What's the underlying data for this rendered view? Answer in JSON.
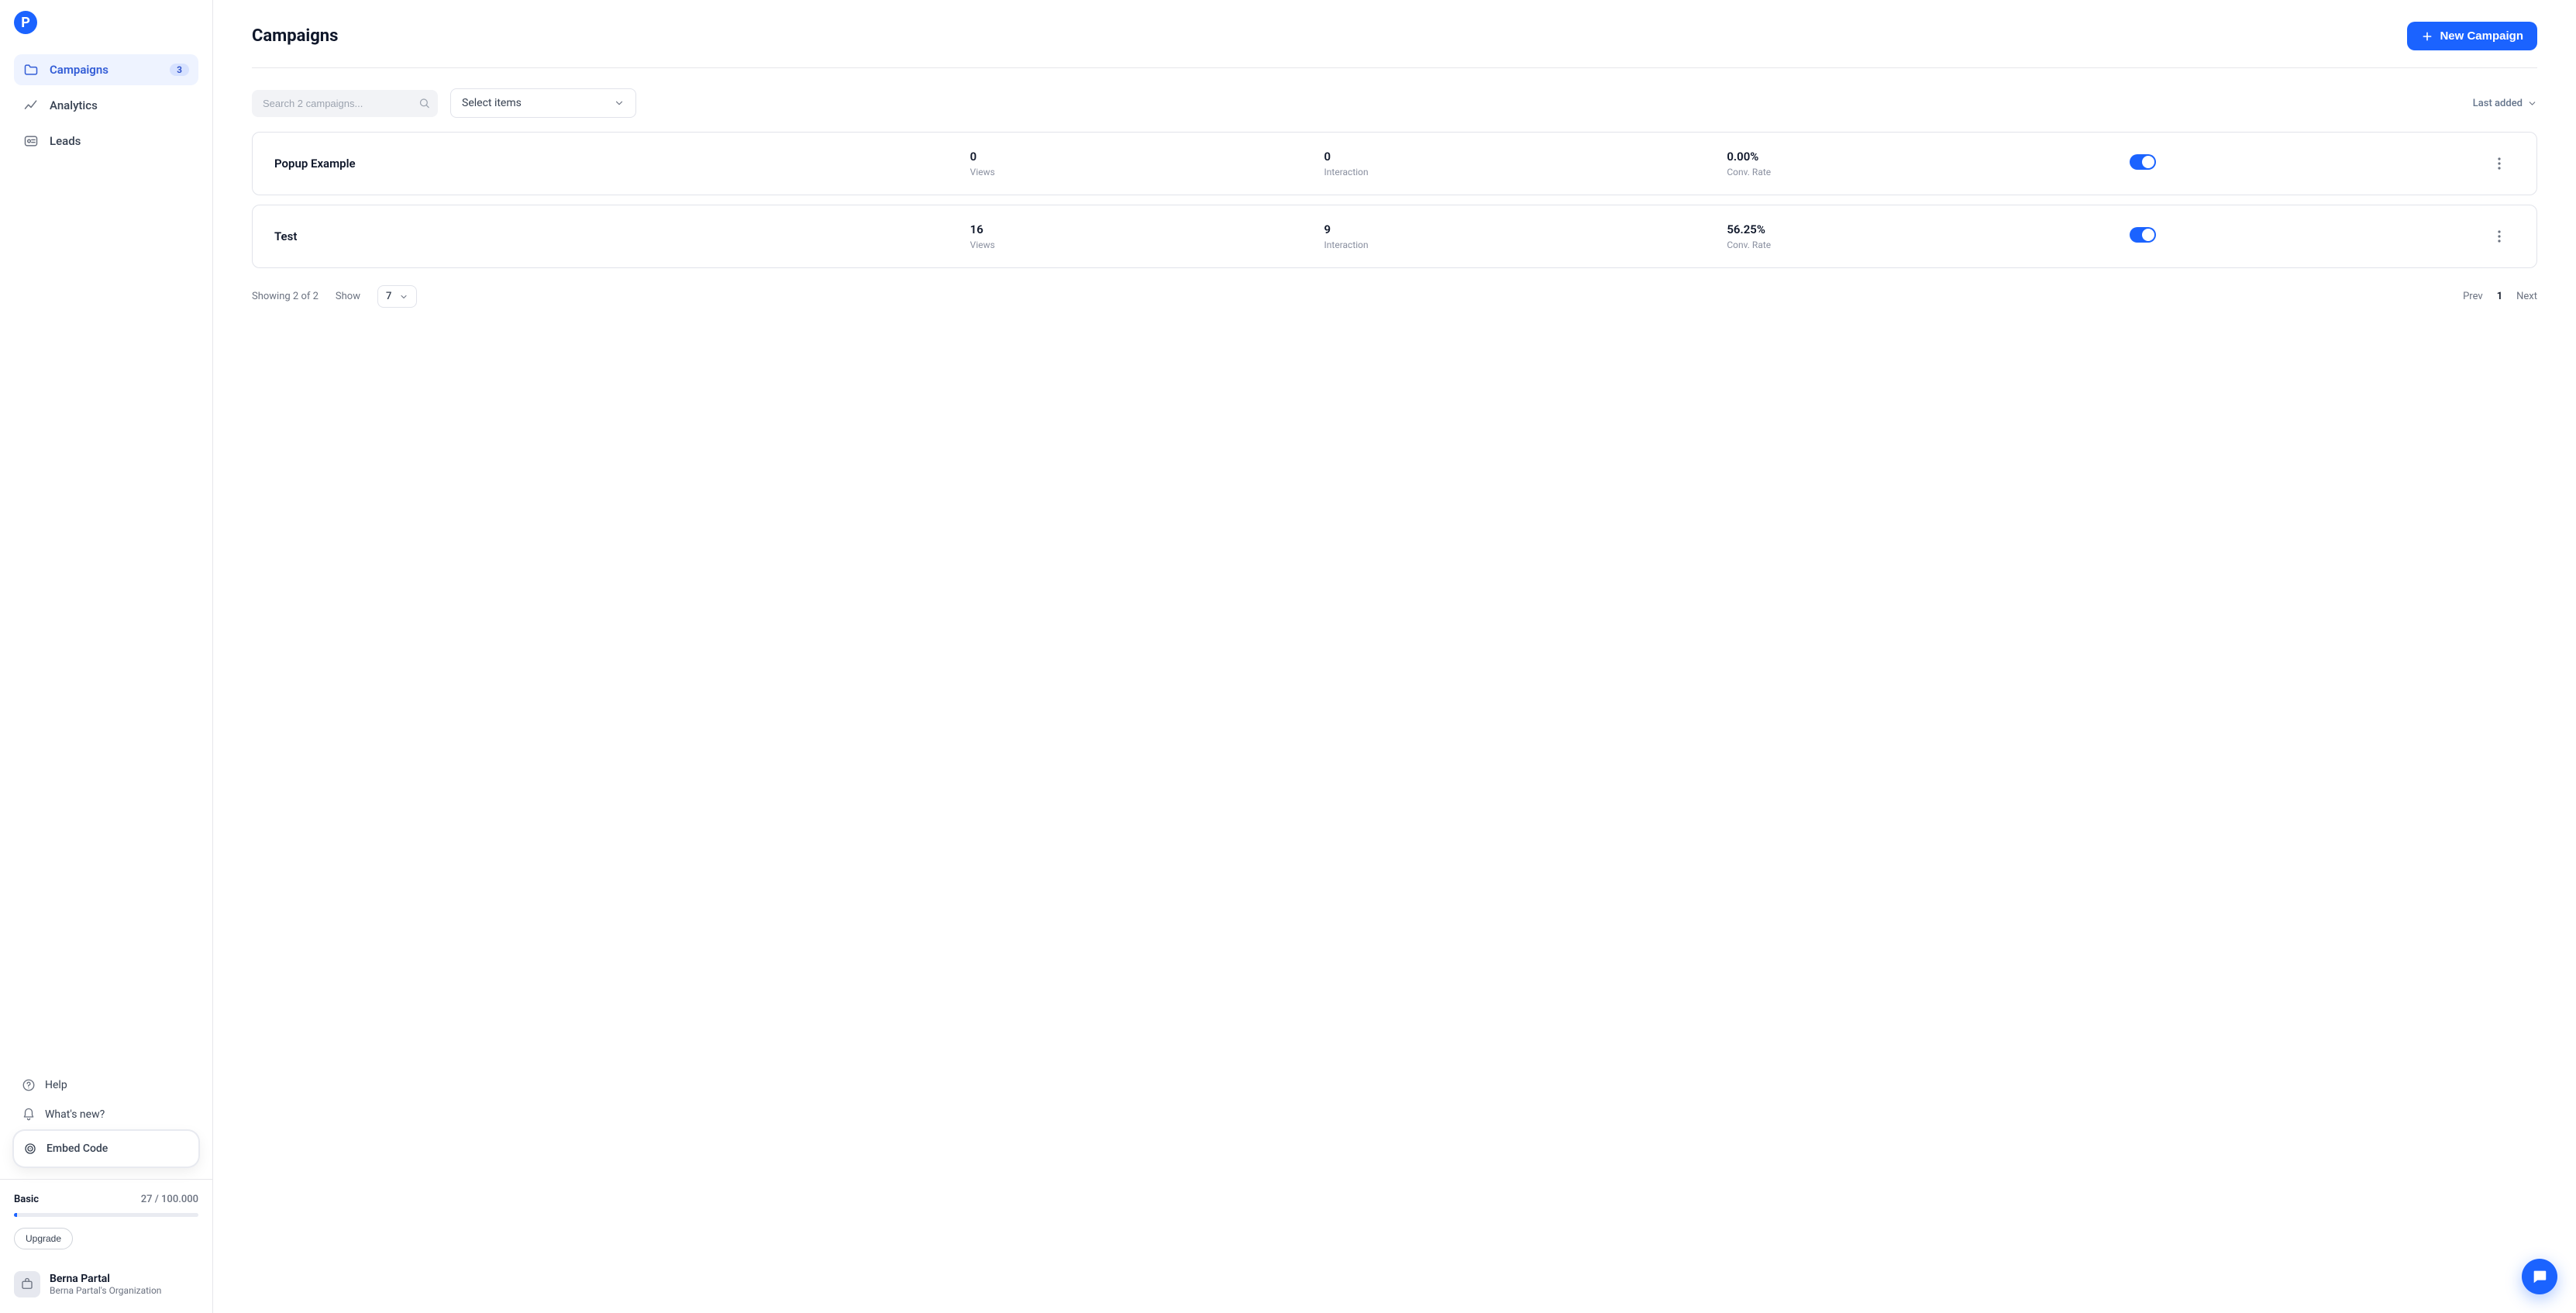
{
  "brand": {
    "logo_letter": "P"
  },
  "sidebar": {
    "items": [
      {
        "label": "Campaigns",
        "badge": "3"
      },
      {
        "label": "Analytics"
      },
      {
        "label": "Leads"
      }
    ],
    "bottom": [
      {
        "label": "Help"
      },
      {
        "label": "What's new?"
      },
      {
        "label": "Embed Code"
      }
    ]
  },
  "plan": {
    "name": "Basic",
    "usage_label": "27 / 100.000",
    "usage_used": 27,
    "usage_total": 100000,
    "upgrade_label": "Upgrade"
  },
  "user": {
    "name": "Berna Partal",
    "org": "Berna Partal's Organization"
  },
  "page": {
    "title": "Campaigns",
    "new_campaign_label": "New Campaign"
  },
  "toolbar": {
    "search_placeholder": "Search 2 campaigns...",
    "select_label": "Select items",
    "sort_label": "Last added"
  },
  "headers": {
    "views": "Views",
    "interaction": "Interaction",
    "conv_rate": "Conv. Rate"
  },
  "rows": [
    {
      "name": "Popup Example",
      "views": "0",
      "interaction": "0",
      "conv_rate": "0.00%",
      "enabled": true
    },
    {
      "name": "Test",
      "views": "16",
      "interaction": "9",
      "conv_rate": "56.25%",
      "enabled": true
    }
  ],
  "pagination": {
    "showing": "Showing 2 of 2",
    "show_label": "Show",
    "page_size": "7",
    "prev": "Prev",
    "cur": "1",
    "next": "Next"
  },
  "colors": {
    "brand": "#1B63FF"
  }
}
